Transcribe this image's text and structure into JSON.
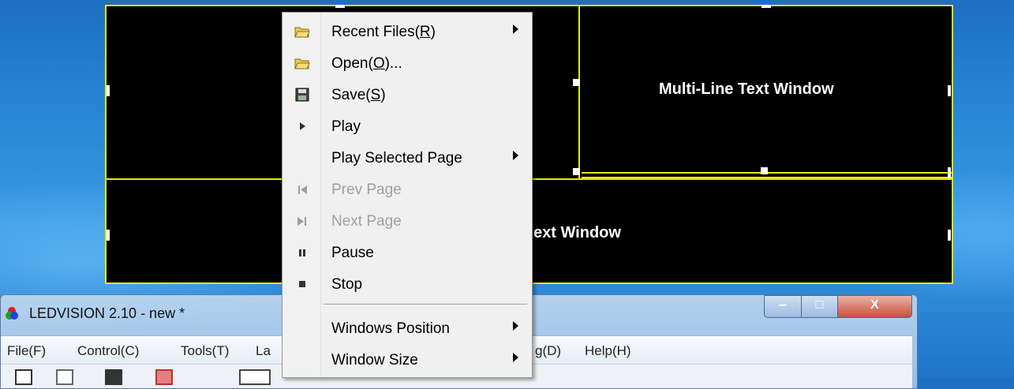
{
  "led_screen": {
    "windows": [
      {
        "label": "Multi-Line Text Window"
      },
      {
        "label": "ext Window"
      }
    ]
  },
  "app_window": {
    "title": "LEDVISION 2.10 - new *",
    "menubar": [
      {
        "label": "File(F)"
      },
      {
        "label": "Control(C)"
      },
      {
        "label": "Tools(T)"
      },
      {
        "label": "La"
      },
      {
        "label": "g(D)"
      },
      {
        "label": "Help(H)"
      }
    ],
    "buttons": {
      "minimize": "‒",
      "maximize": "□",
      "close": "X"
    }
  },
  "context_menu": {
    "items": [
      {
        "label_pre": "Recent Files(",
        "mnemonic": "R",
        "label_post": ")",
        "icon": "open-folder-icon",
        "submenu": true,
        "enabled": true
      },
      {
        "label_pre": "Open(",
        "mnemonic": "O",
        "label_post": ")...",
        "icon": "open-folder-icon",
        "submenu": false,
        "enabled": true
      },
      {
        "label_pre": "Save(",
        "mnemonic": "S",
        "label_post": ")",
        "icon": "floppy-disk-icon",
        "submenu": false,
        "enabled": true
      },
      {
        "label": "Play",
        "icon": "play-icon",
        "submenu": false,
        "enabled": true
      },
      {
        "label": "Play Selected Page",
        "icon": "",
        "submenu": true,
        "enabled": true
      },
      {
        "label": "Prev Page",
        "icon": "prev-page-icon",
        "submenu": false,
        "enabled": false
      },
      {
        "label": "Next Page",
        "icon": "next-page-icon",
        "submenu": false,
        "enabled": false
      },
      {
        "label": "Pause",
        "icon": "pause-icon",
        "submenu": false,
        "enabled": true
      },
      {
        "label": "Stop",
        "icon": "stop-icon",
        "submenu": false,
        "enabled": true
      },
      {
        "label": "Windows Position",
        "icon": "",
        "submenu": true,
        "enabled": true
      },
      {
        "label": "Window Size",
        "icon": "",
        "submenu": true,
        "enabled": true
      }
    ]
  },
  "colors": {
    "led_border": "#e8e800",
    "led_background": "#000000",
    "desktop": "#2a8ad8"
  }
}
